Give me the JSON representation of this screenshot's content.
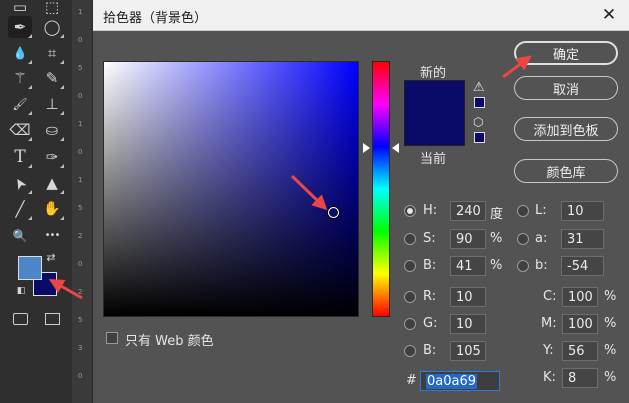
{
  "toolbar": {
    "tools": [
      {
        "name": "marquee-tool-icon",
        "glyph": "▭"
      },
      {
        "name": "artboard-tool-icon",
        "glyph": "⬚"
      },
      {
        "name": "eyedropper-tool-icon",
        "glyph": "✒"
      },
      {
        "name": "lasso-tool-icon",
        "glyph": "◯"
      },
      {
        "name": "blur-tool-icon",
        "glyph": "💧"
      },
      {
        "name": "crop-tool-icon",
        "glyph": "⌗"
      },
      {
        "name": "magic-wand-tool-icon",
        "glyph": "⚚"
      },
      {
        "name": "color-sampler-tool-icon",
        "glyph": "✎"
      },
      {
        "name": "brush-tool-icon",
        "glyph": "🖌"
      },
      {
        "name": "stamp-tool-icon",
        "glyph": "⊥"
      },
      {
        "name": "eraser-tool-icon",
        "glyph": "⌫"
      },
      {
        "name": "paint-bucket-tool-icon",
        "glyph": "⛀"
      },
      {
        "name": "type-tool-icon",
        "glyph": "T"
      },
      {
        "name": "pen-tool-icon",
        "glyph": "✑"
      },
      {
        "name": "selection-tool-icon",
        "glyph": "➤"
      },
      {
        "name": "shape-tool-icon",
        "glyph": "▲"
      },
      {
        "name": "line-tool-icon",
        "glyph": "╱"
      },
      {
        "name": "hand-tool-icon",
        "glyph": "✋"
      },
      {
        "name": "zoom-tool-icon",
        "glyph": "🔍"
      },
      {
        "name": "more-tools-icon",
        "glyph": "•••"
      }
    ],
    "foreground_color": "#4a86c8",
    "background_color": "#0a0a69"
  },
  "dialog": {
    "title": "拾色器（背景色）",
    "close_glyph": "✕",
    "label_new": "新的",
    "label_current": "当前",
    "new_color": "#0a0a69",
    "current_color": "#0a0a69",
    "buttons": {
      "ok": "确定",
      "cancel": "取消",
      "add_to_swatches": "添加到色板",
      "color_libraries": "颜色库"
    },
    "hsb": [
      {
        "label": "H:",
        "value": "240",
        "unit": "度",
        "checked": true
      },
      {
        "label": "S:",
        "value": "90",
        "unit": "%",
        "checked": false
      },
      {
        "label": "B:",
        "value": "41",
        "unit": "%",
        "checked": false
      }
    ],
    "lab": [
      {
        "label": "L:",
        "value": "10"
      },
      {
        "label": "a:",
        "value": "31"
      },
      {
        "label": "b:",
        "value": "-54"
      }
    ],
    "rgb": [
      {
        "label": "R:",
        "value": "10"
      },
      {
        "label": "G:",
        "value": "10"
      },
      {
        "label": "B:",
        "value": "105"
      }
    ],
    "cmyk": [
      {
        "label": "C:",
        "value": "100",
        "unit": "%"
      },
      {
        "label": "M:",
        "value": "100",
        "unit": "%"
      },
      {
        "label": "Y:",
        "value": "56",
        "unit": "%"
      },
      {
        "label": "K:",
        "value": "8",
        "unit": "%"
      }
    ],
    "hex_label": "#",
    "hex_value": "0a0a69",
    "web_only_label": "只有 Web 颜色",
    "web_only_checked": false
  }
}
